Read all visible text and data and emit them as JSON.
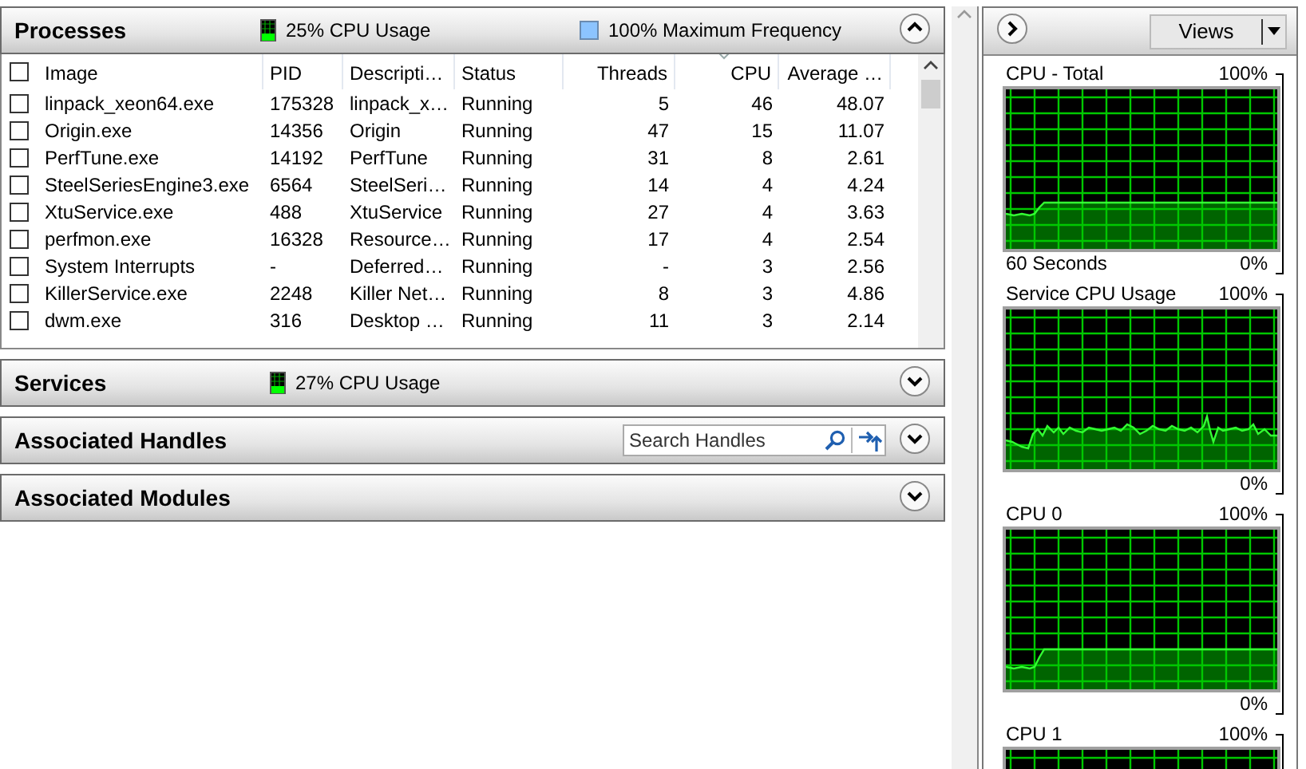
{
  "processes": {
    "title": "Processes",
    "cpu_usage": "25% CPU Usage",
    "max_frequency": "100% Maximum Frequency",
    "expanded": true,
    "select_all_checked": false,
    "columns": [
      {
        "label": "Image",
        "kind": "text",
        "sorted": false
      },
      {
        "label": "PID",
        "kind": "text",
        "sorted": false
      },
      {
        "label": "Descripti…",
        "kind": "text",
        "sorted": false
      },
      {
        "label": "Status",
        "kind": "text",
        "sorted": false
      },
      {
        "label": "Threads",
        "kind": "number",
        "sorted": false
      },
      {
        "label": "CPU",
        "kind": "number",
        "sorted": true
      },
      {
        "label": "Average …",
        "kind": "number",
        "sorted": false
      }
    ],
    "rows": [
      {
        "checked": false,
        "cells": [
          "linpack_xeon64.exe",
          "175328",
          "linpack_x…",
          "Running",
          "5",
          "46",
          "48.07"
        ]
      },
      {
        "checked": false,
        "cells": [
          "Origin.exe",
          "14356",
          "Origin",
          "Running",
          "47",
          "15",
          "11.07"
        ]
      },
      {
        "checked": false,
        "cells": [
          "PerfTune.exe",
          "14192",
          "PerfTune",
          "Running",
          "31",
          "8",
          "2.61"
        ]
      },
      {
        "checked": false,
        "cells": [
          "SteelSeriesEngine3.exe",
          "6564",
          "SteelSeri…",
          "Running",
          "14",
          "4",
          "4.24"
        ]
      },
      {
        "checked": false,
        "cells": [
          "XtuService.exe",
          "488",
          "XtuService",
          "Running",
          "27",
          "4",
          "3.63"
        ]
      },
      {
        "checked": false,
        "cells": [
          "perfmon.exe",
          "16328",
          "Resource…",
          "Running",
          "17",
          "4",
          "2.54"
        ]
      },
      {
        "checked": false,
        "cells": [
          "System Interrupts",
          "-",
          "Deferred…",
          "Running",
          "-",
          "3",
          "2.56"
        ]
      },
      {
        "checked": false,
        "cells": [
          "KillerService.exe",
          "2248",
          "Killer Net…",
          "Running",
          "8",
          "3",
          "4.86"
        ]
      },
      {
        "checked": false,
        "cells": [
          "dwm.exe",
          "316",
          "Desktop …",
          "Running",
          "11",
          "3",
          "2.14"
        ]
      }
    ]
  },
  "services": {
    "title": "Services",
    "cpu_usage": "27% CPU Usage",
    "expanded": false
  },
  "associated_handles": {
    "title": "Associated Handles",
    "search": {
      "placeholder": "Search Handles"
    },
    "expanded": false
  },
  "associated_modules": {
    "title": "Associated Modules",
    "expanded": false
  },
  "monitor": {
    "expanded": false,
    "views_button": "Views",
    "graphs": [
      {
        "title": "CPU - Total",
        "max": "100%",
        "time_span": "60 Seconds",
        "min": "0%"
      },
      {
        "title": "Service CPU Usage",
        "max": "100%",
        "min": "0%"
      },
      {
        "title": "CPU 0",
        "max": "100%",
        "min": "0%"
      },
      {
        "title": "CPU 1",
        "max": "100%"
      }
    ]
  }
}
